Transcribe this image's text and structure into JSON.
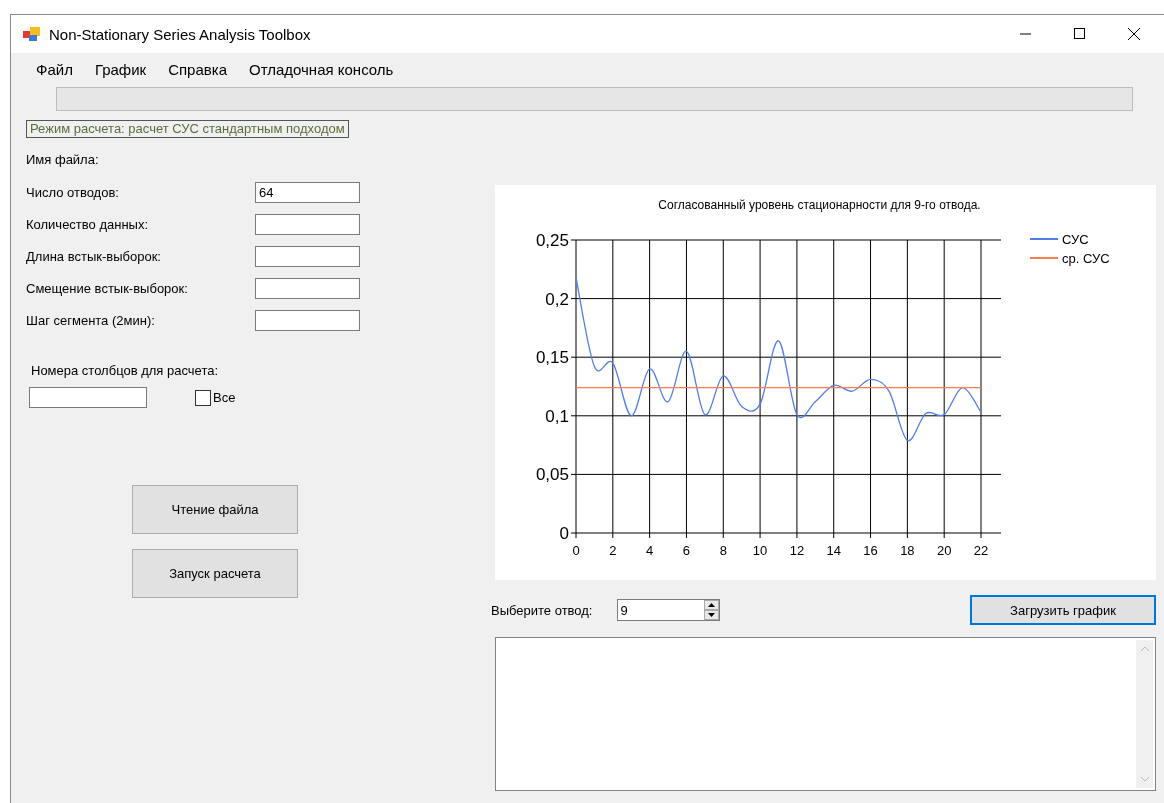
{
  "window": {
    "title": "Non-Stationary Series Analysis Toolbox"
  },
  "menu": [
    "Файл",
    "График",
    "Справка",
    "Отладочная консоль"
  ],
  "mode_label": "Режим расчета: расчет СУС стандартным подходом",
  "file_label": "Имя файла:",
  "fields": [
    {
      "label": "Число отводов:",
      "value": "64"
    },
    {
      "label": "Количество данных:"
    },
    {
      "label": "Длина встык-выборок:"
    },
    {
      "label": "Смещение встык-выборок:"
    },
    {
      "label": "Шаг сегмента (2мин):"
    }
  ],
  "columns": {
    "label": "Номера столбцов для расчета:",
    "all_checkbox": {
      "label": "Все",
      "checked": false
    }
  },
  "buttons": [
    "Чтение файла",
    "Запуск расчета"
  ],
  "chart": {
    "chart_data": {
      "type": "line",
      "title": "Согласованный уровень стационарности для 9-го отвода.",
      "x": [
        0,
        1,
        2,
        3,
        4,
        5,
        6,
        7,
        8,
        9,
        10,
        11,
        12,
        13,
        14,
        15,
        16,
        17,
        18,
        19,
        20,
        21,
        22
      ],
      "xlim": [
        0,
        22
      ],
      "grid": true,
      "legend": true,
      "ylim": [
        0,
        0.25
      ],
      "xticks": [
        0,
        2,
        4,
        6,
        8,
        10,
        12,
        14,
        16,
        18,
        20,
        22
      ],
      "yticks": [
        {
          "value": 0,
          "label": "0"
        },
        {
          "value": 0.05,
          "label": "0,05"
        },
        {
          "value": 0.1,
          "label": "0,1"
        },
        {
          "value": 0.15,
          "label": "0,15"
        },
        {
          "value": 0.2,
          "label": "0,2"
        },
        {
          "value": 0.25,
          "label": "0,25"
        }
      ],
      "series": [
        {
          "name": "СУС",
          "color": "#4f7fe8",
          "values": [
            0.218,
            0.142,
            0.145,
            0.1,
            0.14,
            0.112,
            0.155,
            0.101,
            0.134,
            0.108,
            0.11,
            0.164,
            0.101,
            0.112,
            0.126,
            0.121,
            0.131,
            0.121,
            0.079,
            0.102,
            0.101,
            0.124,
            0.103
          ]
        },
        {
          "name": "ср. СУС",
          "color": "#ff7f50",
          "values": [
            0.124,
            0.124,
            0.124,
            0.124,
            0.124,
            0.124,
            0.124,
            0.124,
            0.124,
            0.124,
            0.124,
            0.124,
            0.124,
            0.124,
            0.124,
            0.124,
            0.124,
            0.124,
            0.124,
            0.124,
            0.124,
            0.124,
            0.124
          ]
        }
      ]
    }
  },
  "lead_select": {
    "label": "Выберите отвод:",
    "value": "9"
  },
  "load_button": "Загрузить график",
  "output": {
    "kind": "textbox"
  }
}
